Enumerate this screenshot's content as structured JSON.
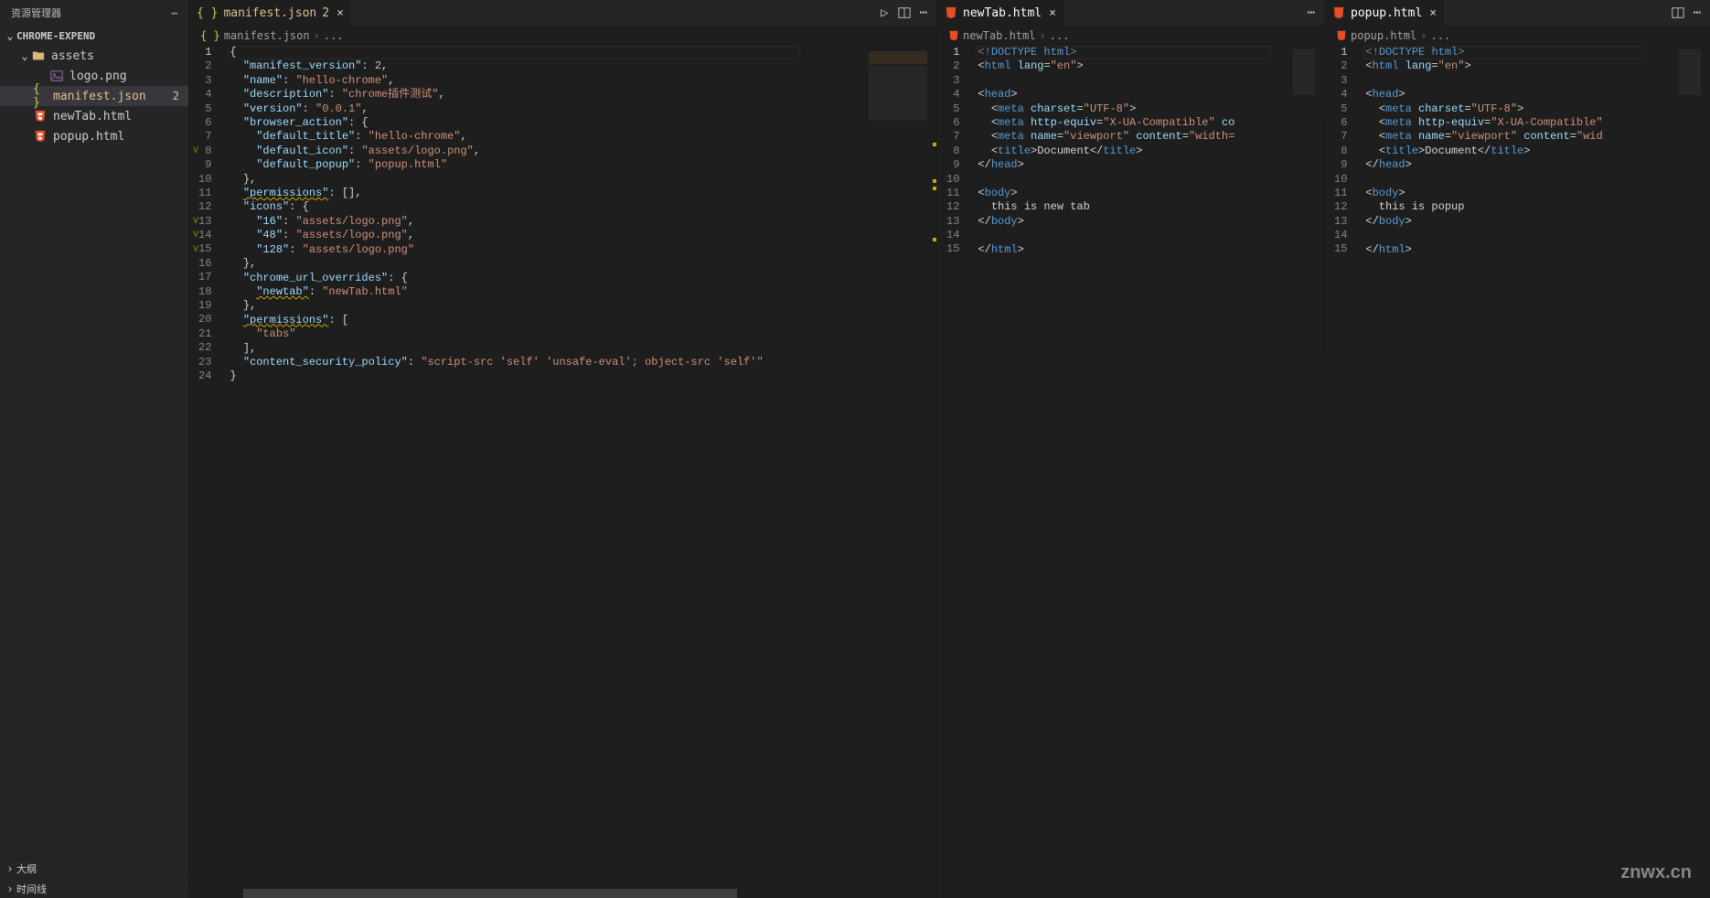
{
  "sidebar": {
    "title": "资源管理器",
    "folder": "CHROME-EXPEND",
    "assets_label": "assets",
    "items": [
      {
        "label": "logo.png",
        "type": "img",
        "indent": 54
      },
      {
        "label": "manifest.json",
        "type": "json",
        "indent": 36,
        "modified": true,
        "badge": "2",
        "active": true
      },
      {
        "label": "newTab.html",
        "type": "html",
        "indent": 36
      },
      {
        "label": "popup.html",
        "type": "html",
        "indent": 36
      }
    ],
    "bottom": [
      {
        "label": "大纲"
      },
      {
        "label": "时间线"
      }
    ]
  },
  "tabs": {
    "t1": {
      "label": "manifest.json",
      "badge": "2"
    },
    "t2": {
      "label": "newTab.html"
    },
    "t3": {
      "label": "popup.html"
    }
  },
  "breadcrumbs": {
    "b1_file": "manifest.json",
    "b2_file": "newTab.html",
    "b3_file": "popup.html",
    "more": "..."
  },
  "code1": {
    "l1": "{",
    "l2_k": "\"manifest_version\"",
    "l2_v": "2",
    "l3_k": "\"name\"",
    "l3_v": "\"hello-chrome\"",
    "l4_k": "\"description\"",
    "l4_v": "\"chrome插件测试\"",
    "l5_k": "\"version\"",
    "l5_v": "\"0.0.1\"",
    "l6_k": "\"browser_action\"",
    "l7_k": "\"default_title\"",
    "l7_v": "\"hello-chrome\"",
    "l8_k": "\"default_icon\"",
    "l8_v": "\"assets/logo.png\"",
    "l9_k": "\"default_popup\"",
    "l9_v": "\"popup.html\"",
    "l10": "},",
    "l11_k": "\"permissions\"",
    "l12_k": "\"icons\"",
    "l13_k": "\"16\"",
    "l13_v": "\"assets/logo.png\"",
    "l14_k": "\"48\"",
    "l14_v": "\"assets/logo.png\"",
    "l15_k": "\"128\"",
    "l15_v": "\"assets/logo.png\"",
    "l16": "},",
    "l17_k": "\"chrome_url_overrides\"",
    "l18_k": "\"newtab\"",
    "l18_v": "\"newTab.html\"",
    "l19": "},",
    "l20_k": "\"permissions\"",
    "l21_v": "\"tabs\"",
    "l22": "],",
    "l23_k": "\"content_security_policy\"",
    "l23_v": "\"script-src 'self' 'unsafe-eval'; object-src 'self'\"",
    "l24": "}"
  },
  "code2": {
    "doctype": "DOCTYPE",
    "html": "html",
    "lang_attr": "lang",
    "lang_val": "\"en\"",
    "head": "head",
    "meta": "meta",
    "charset_attr": "charset",
    "charset_val": "\"UTF-8\"",
    "httpequiv_attr": "http-equiv",
    "httpequiv_val": "\"X-UA-Compatible\"",
    "content_attr": "content",
    "content_val_cut1": "co",
    "name_attr": "name",
    "viewport_val": "\"viewport\"",
    "width_val_cut1": "\"width=",
    "title": "title",
    "title_text": "Document",
    "body": "body",
    "body_text": "this is new tab"
  },
  "code3": {
    "width_val_cut2": "\"wid",
    "body_text": "this is popup"
  },
  "watermark": "znwx.cn",
  "line_count_1": 24,
  "line_count_2": 15,
  "line_count_3": 15
}
